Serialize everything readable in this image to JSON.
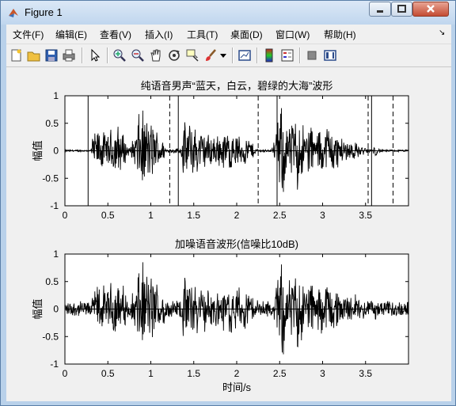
{
  "window": {
    "title": "Figure 1"
  },
  "menu": [
    {
      "label": "文件(F)"
    },
    {
      "label": "编辑(E)"
    },
    {
      "label": "查看(V)"
    },
    {
      "label": "插入(I)"
    },
    {
      "label": "工具(T)"
    },
    {
      "label": "桌面(D)"
    },
    {
      "label": "窗口(W)"
    },
    {
      "label": "帮助(H)"
    }
  ],
  "toolbar_icons": [
    "new-figure-icon",
    "open-icon",
    "save-icon",
    "print-icon",
    "pointer-icon",
    "zoom-in-icon",
    "zoom-out-icon",
    "pan-icon",
    "rotate-icon",
    "data-cursor-icon",
    "brush-icon",
    "link-icon",
    "colorbar-icon",
    "legend-icon",
    "hide-plot-tools-icon",
    "show-plot-tools-icon"
  ],
  "chart_data": [
    {
      "type": "line",
      "title": "纯语音男声“蓝天，白云，碧绿的大海”波形",
      "xlabel": "",
      "ylabel": "幅值",
      "xlim": [
        0,
        4
      ],
      "ylim": [
        -1,
        1
      ],
      "xticks": [
        "0",
        "0.5",
        "1",
        "1.5",
        "2",
        "2.5",
        "3",
        "3.5"
      ],
      "yticks": [
        "1",
        "0.5",
        "0",
        "-0.5",
        "-1"
      ],
      "grid": false,
      "series": [
        {
          "envelope": [
            [
              0.0,
              0.02
            ],
            [
              0.3,
              0.02
            ],
            [
              0.32,
              0.3
            ],
            [
              0.4,
              0.45
            ],
            [
              0.5,
              0.3
            ],
            [
              0.55,
              0.5
            ],
            [
              0.62,
              0.55
            ],
            [
              0.68,
              0.35
            ],
            [
              0.75,
              0.05
            ],
            [
              0.82,
              0.4
            ],
            [
              0.86,
              0.75
            ],
            [
              0.9,
              0.8
            ],
            [
              0.96,
              0.65
            ],
            [
              1.03,
              0.55
            ],
            [
              1.08,
              0.4
            ],
            [
              1.13,
              0.25
            ],
            [
              1.18,
              0.05
            ],
            [
              1.35,
              0.05
            ],
            [
              1.38,
              0.55
            ],
            [
              1.45,
              0.6
            ],
            [
              1.55,
              0.45
            ],
            [
              1.65,
              0.35
            ],
            [
              1.75,
              0.3
            ],
            [
              1.85,
              0.4
            ],
            [
              1.95,
              0.35
            ],
            [
              2.05,
              0.3
            ],
            [
              2.15,
              0.28
            ],
            [
              2.22,
              0.05
            ],
            [
              2.4,
              0.02
            ],
            [
              2.45,
              0.3
            ],
            [
              2.5,
              0.85
            ],
            [
              2.55,
              0.88
            ],
            [
              2.6,
              0.55
            ],
            [
              2.66,
              0.6
            ],
            [
              2.71,
              0.8
            ],
            [
              2.76,
              0.62
            ],
            [
              2.8,
              0.4
            ],
            [
              2.83,
              0.7
            ],
            [
              2.86,
              0.62
            ],
            [
              2.9,
              0.25
            ],
            [
              2.95,
              0.5
            ],
            [
              2.99,
              0.55
            ],
            [
              3.02,
              0.2
            ],
            [
              3.05,
              0.6
            ],
            [
              3.1,
              0.55
            ],
            [
              3.15,
              0.35
            ],
            [
              3.25,
              0.25
            ],
            [
              3.35,
              0.2
            ],
            [
              3.45,
              0.1
            ],
            [
              3.52,
              0.05
            ],
            [
              3.58,
              0.05
            ],
            [
              3.62,
              0.1
            ],
            [
              3.65,
              0.05
            ],
            [
              3.7,
              0.02
            ],
            [
              4.0,
              0.02
            ]
          ]
        }
      ],
      "markers": [
        {
          "x": 0.27,
          "style": "solid"
        },
        {
          "x": 1.22,
          "style": "dashed"
        },
        {
          "x": 1.32,
          "style": "solid"
        },
        {
          "x": 2.25,
          "style": "dashed"
        },
        {
          "x": 2.47,
          "style": "solid"
        },
        {
          "x": 3.53,
          "style": "dashed"
        },
        {
          "x": 3.57,
          "style": "solid"
        },
        {
          "x": 3.82,
          "style": "dashed"
        }
      ]
    },
    {
      "type": "line",
      "title": "加噪语音波形(信噪比10dB)",
      "xlabel": "时间/s",
      "ylabel": "幅值",
      "xlim": [
        0,
        4
      ],
      "ylim": [
        -1,
        1
      ],
      "xticks": [
        "0",
        "0.5",
        "1",
        "1.5",
        "2",
        "2.5",
        "3",
        "3.5"
      ],
      "yticks": [
        "1",
        "0.5",
        "0",
        "-0.5",
        "-1"
      ],
      "grid": false,
      "noise_level": 0.13,
      "series": [
        {
          "envelope": "same as upper plot with added white noise"
        }
      ]
    }
  ]
}
